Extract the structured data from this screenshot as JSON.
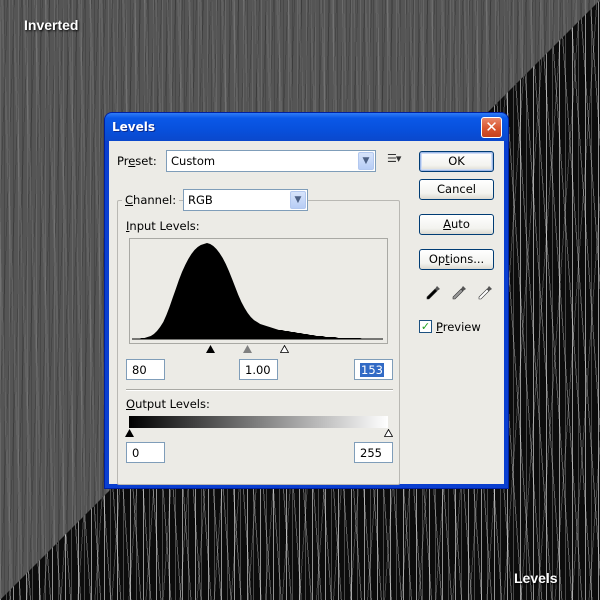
{
  "overlay_labels": {
    "top_left": "Inverted",
    "bottom_right": "Levels"
  },
  "dialog": {
    "title": "Levels",
    "close_icon": "close-icon",
    "preset": {
      "label_prefix": "Pr",
      "label_accel": "e",
      "label_suffix": "set:",
      "value": "Custom",
      "menu_icon": "preset-options-icon"
    },
    "channel": {
      "label_accel": "C",
      "label_suffix": "hannel:",
      "value": "RGB"
    },
    "input_levels": {
      "label_accel": "I",
      "label_suffix": "nput Levels:",
      "black": "80",
      "gamma": "1.00",
      "white": "153",
      "black_value": 80,
      "white_value": 153,
      "range_max": 255
    },
    "output_levels": {
      "label_accel": "O",
      "label_suffix": "utput Levels:",
      "black": "0",
      "white": "255"
    },
    "buttons": {
      "ok": "OK",
      "cancel": "Cancel",
      "auto_accel": "A",
      "auto_suffix": "uto",
      "options_prefix": "Op",
      "options_accel": "t",
      "options_suffix": "ions..."
    },
    "eyedroppers": [
      "black-point-eyedropper-icon",
      "gray-point-eyedropper-icon",
      "white-point-eyedropper-icon"
    ],
    "preview": {
      "checked": true,
      "label_accel": "P",
      "label_suffix": "review"
    },
    "histogram": {
      "bins": [
        0,
        0,
        0,
        1,
        1,
        2,
        3,
        5,
        8,
        12,
        17,
        24,
        32,
        41,
        50,
        59,
        67,
        74,
        80,
        85,
        89,
        92,
        94,
        95,
        96,
        95,
        93,
        90,
        86,
        81,
        75,
        68,
        60,
        52,
        44,
        37,
        31,
        26,
        22,
        19,
        17,
        15,
        14,
        13,
        12,
        11,
        10,
        9,
        9,
        8,
        8,
        7,
        7,
        6,
        6,
        5,
        5,
        4,
        4,
        3,
        3,
        3,
        2,
        2,
        2,
        2,
        1,
        1,
        1,
        1,
        1,
        1,
        1,
        1,
        0,
        0,
        0,
        0,
        0,
        0
      ]
    }
  }
}
